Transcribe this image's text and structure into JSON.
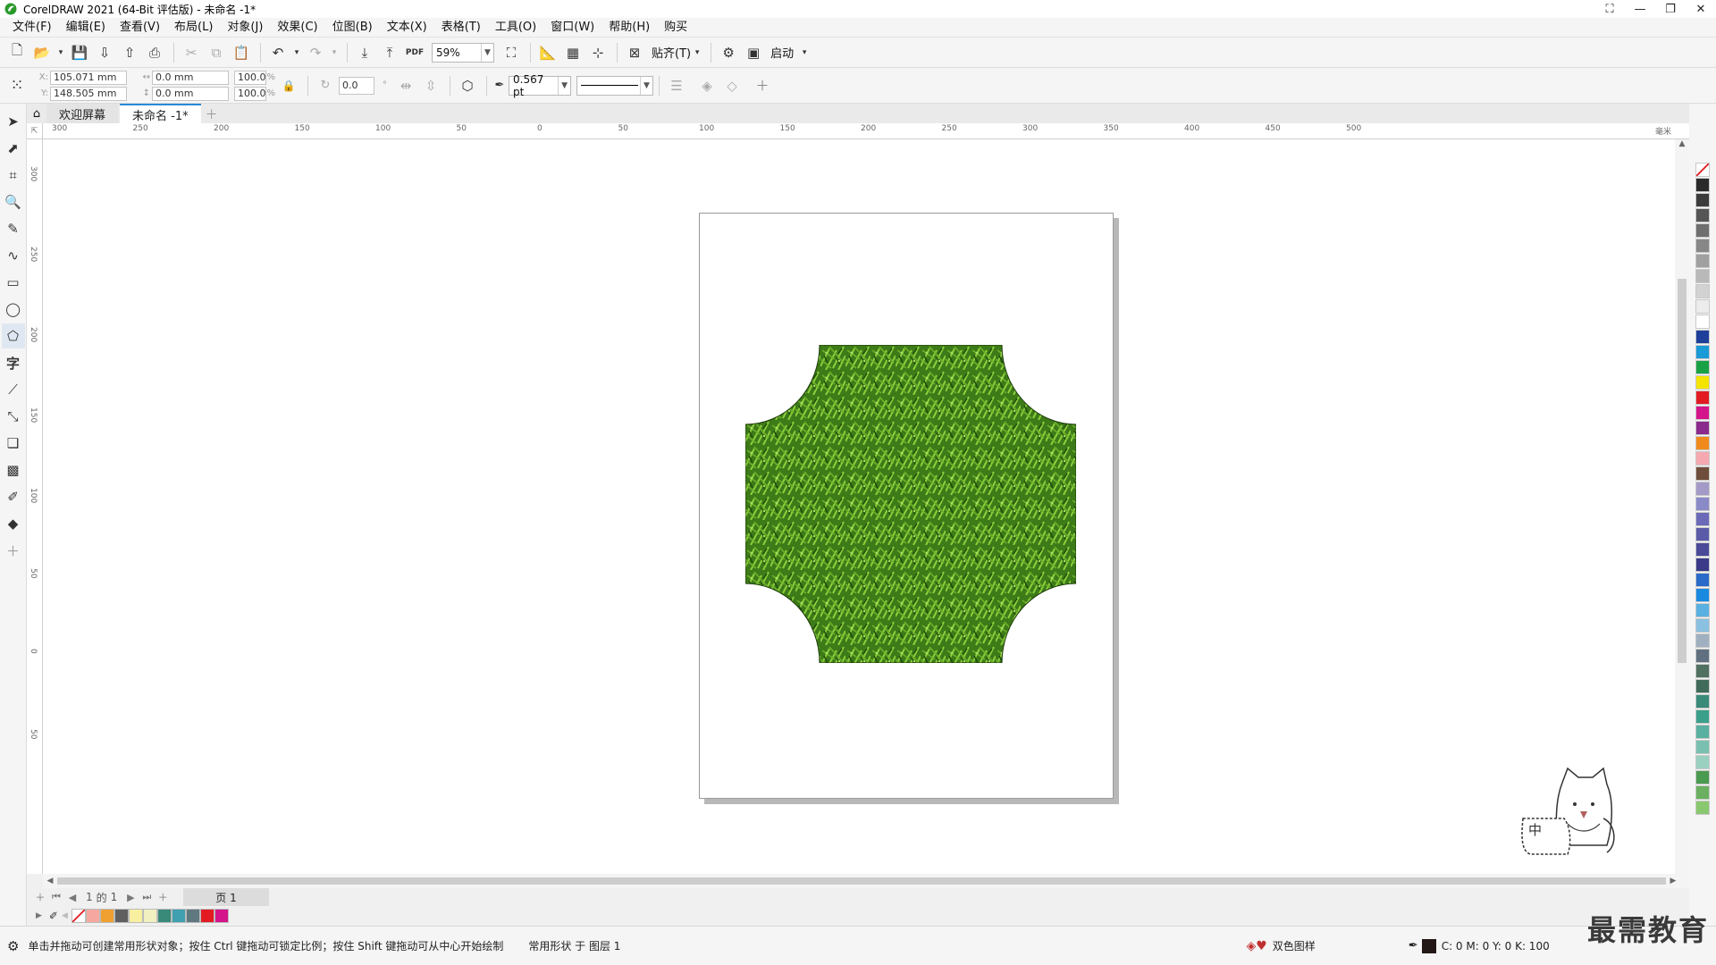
{
  "window": {
    "title": "CorelDRAW 2021 (64-Bit 评估版) - 未命名 -1*"
  },
  "menu": [
    {
      "label": "文件(F)"
    },
    {
      "label": "编辑(E)"
    },
    {
      "label": "查看(V)"
    },
    {
      "label": "布局(L)"
    },
    {
      "label": "对象(J)"
    },
    {
      "label": "效果(C)"
    },
    {
      "label": "位图(B)"
    },
    {
      "label": "文本(X)"
    },
    {
      "label": "表格(T)"
    },
    {
      "label": "工具(O)"
    },
    {
      "label": "窗口(W)"
    },
    {
      "label": "帮助(H)"
    },
    {
      "label": "购买"
    }
  ],
  "toolbar": {
    "zoom": "59%",
    "snap_label": "贴齐(T)",
    "launch_label": "启动",
    "pdf_label": "PDF"
  },
  "propbar": {
    "x": "105.071 mm",
    "y": "148.505 mm",
    "w": "0.0 mm",
    "h": "0.0 mm",
    "scale_x": "100.0",
    "scale_y": "100.0",
    "scale_unit": "%",
    "rotation": "0.0",
    "outline_width": "0.567 pt",
    "x_label": "X:",
    "y_label": "Y:"
  },
  "tabs": [
    {
      "label": "欢迎屏幕",
      "active": false
    },
    {
      "label": "未命名 -1*",
      "active": true
    }
  ],
  "ruler": {
    "corner": "⇱",
    "h_labels": [
      "300",
      "250",
      "200",
      "150",
      "100",
      "50",
      "0",
      "50",
      "100",
      "150",
      "200",
      "250",
      "300",
      "350",
      "400",
      "450",
      "500"
    ],
    "h_unit": "毫米",
    "v_labels": [
      "300",
      "250",
      "200",
      "150",
      "100",
      "50",
      "0",
      "50"
    ]
  },
  "pagenav": {
    "current": "1",
    "of_label": "的",
    "total": "1",
    "page_tab": "页 1"
  },
  "statusbar": {
    "hint": "单击并拖动可创建常用形状对象；按住 Ctrl 键拖动可锁定比例；按住 Shift 键拖动可从中心开始绘制",
    "object": "常用形状 于 图层 1",
    "fill_label": "双色图样",
    "cmyk": "C: 0 M: 0 Y: 0 K: 100"
  },
  "watermark": "最需教育",
  "input_badge": "中",
  "colors": {
    "accent": "#2a8ad8",
    "grass_dark": "#2f6a12",
    "grass_light": "#8ccf3c"
  },
  "palette": [
    "#2a2a2a",
    "#3c3c3c",
    "#555555",
    "#6e6e6e",
    "#878787",
    "#a0a0a0",
    "#b9b9b9",
    "#d2d2d2",
    "#ececec",
    "#ffffff",
    "#1d3f9a",
    "#1a9ad6",
    "#1aa146",
    "#f5e300",
    "#e21b22",
    "#d4148a",
    "#8a2a8c",
    "#f08a1c",
    "#f6a8b0",
    "#6e4e3a",
    "#a49ac8",
    "#8a8ac8",
    "#6a6ab8",
    "#5a5aa8",
    "#4a4a98",
    "#3a3a88",
    "#2a6ac8",
    "#1a8ae0",
    "#5ab0e0",
    "#8ac0e0",
    "#a0b0c0",
    "#607080",
    "#507060",
    "#406a5a",
    "#3a8a7a",
    "#3aa08a",
    "#5ab0a0",
    "#7ac0b0",
    "#9ad0c0",
    "#4a9a50",
    "#6ab060",
    "#8ac870"
  ],
  "doc_palette": [
    "#f6a8a0",
    "#f0a030",
    "#606060",
    "#f8f0a0",
    "#f0f0c0",
    "#3a8a7a",
    "#40a0b0",
    "#607880",
    "#e21b22",
    "#d4148a"
  ]
}
